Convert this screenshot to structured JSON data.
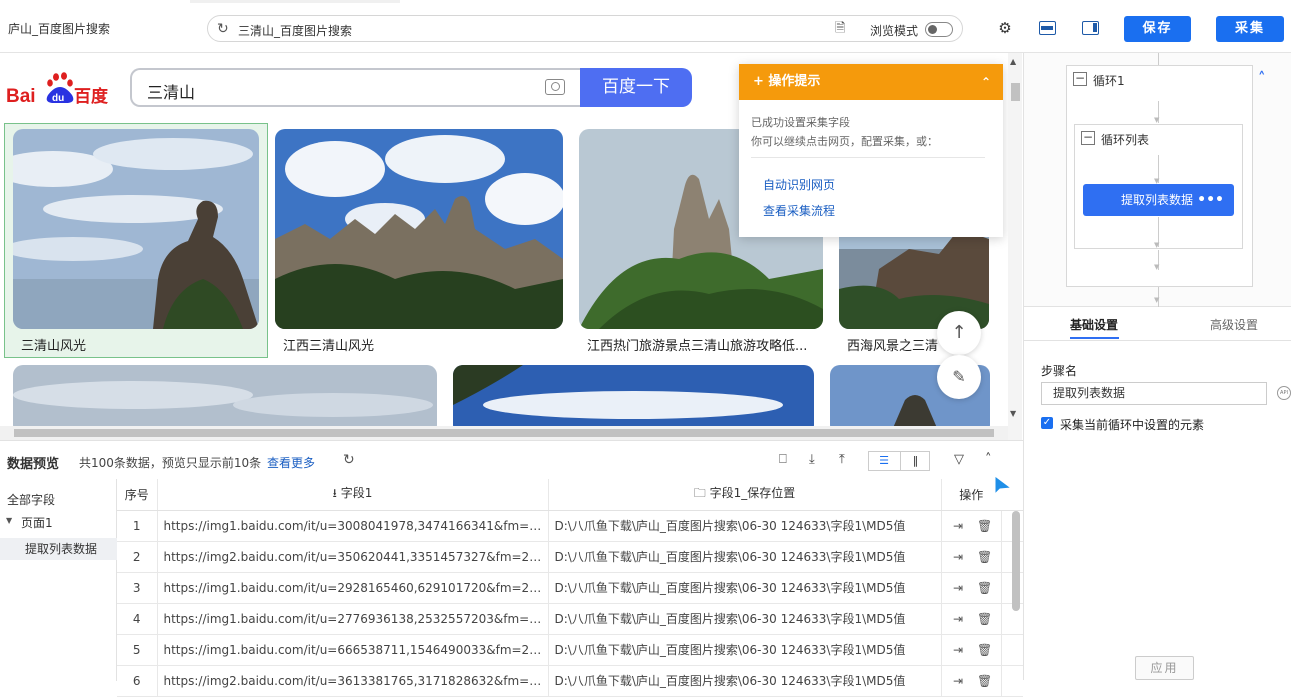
{
  "topbar": {
    "tab_title": "庐山_百度图片搜索",
    "url": "三清山_百度图片搜索",
    "browse_mode_label": "浏览模式",
    "browse_mode_on": false,
    "save_label": "保存",
    "collect_label": "采集",
    "accent_color": "#1a6ff0"
  },
  "webview": {
    "logo_text_bai": "Bai",
    "logo_text_du": "du",
    "logo_text_cn": "百度",
    "search_value": "三清山",
    "search_button": "百度一下",
    "images": [
      {
        "caption": "三清山风光",
        "selected": true
      },
      {
        "caption": "江西三清山风光"
      },
      {
        "caption": "江西热门旅游景点三清山旅游攻略低..."
      },
      {
        "caption": "西海风景之三清"
      }
    ],
    "tips": {
      "title": "操作提示",
      "line1": "已成功设置采集字段",
      "line2": "你可以继续点击网页，配置采集，或：",
      "link1": "自动识别网页",
      "link2": "查看采集流程",
      "header_color": "#f59a0c"
    }
  },
  "flow": {
    "loop1_label": "循环1",
    "loop_list_label": "循环列表",
    "extract_node_label": "提取列表数据",
    "more_label": "•••"
  },
  "settings": {
    "tab_basic": "基础设置",
    "tab_advanced": "高级设置",
    "step_name_label": "步骤名",
    "step_name_value": "提取列表数据",
    "api_label": "API",
    "checkbox_label": "采集当前循环中设置的元素",
    "checkbox_checked": true,
    "apply_label": "应用"
  },
  "preview": {
    "title": "数据预览",
    "summary": "共100条数据，预览只显示前10条",
    "view_more": "查看更多",
    "tree": {
      "all_fields": "全部字段",
      "page1": "页面1",
      "extract": "提取列表数据"
    },
    "columns": {
      "index": "序号",
      "field1": "字段1",
      "field1_path": "字段1_保存位置",
      "ops": "操作"
    },
    "rows": [
      {
        "idx": "1",
        "url": "https://img1.baidu.com/it/u=3008041978,3474166341&fm=253&fmt=...",
        "path": "D:\\八爪鱼下载\\庐山_百度图片搜索\\06-30 124633\\字段1\\MD5值"
      },
      {
        "idx": "2",
        "url": "https://img2.baidu.com/it/u=350620441,3351457327&fm=253&fmt=...",
        "path": "D:\\八爪鱼下载\\庐山_百度图片搜索\\06-30 124633\\字段1\\MD5值"
      },
      {
        "idx": "3",
        "url": "https://img1.baidu.com/it/u=2928165460,629101720&fm=253&fmt=...",
        "path": "D:\\八爪鱼下载\\庐山_百度图片搜索\\06-30 124633\\字段1\\MD5值"
      },
      {
        "idx": "4",
        "url": "https://img1.baidu.com/it/u=2776936138,2532557203&fm=253&fmt=...",
        "path": "D:\\八爪鱼下载\\庐山_百度图片搜索\\06-30 124633\\字段1\\MD5值"
      },
      {
        "idx": "5",
        "url": "https://img1.baidu.com/it/u=666538711,1546490033&fm=253&fmt=...",
        "path": "D:\\八爪鱼下载\\庐山_百度图片搜索\\06-30 124633\\字段1\\MD5值"
      },
      {
        "idx": "6",
        "url": "https://img2.baidu.com/it/u=3613381765,3171828632&fm=253&fmt=...",
        "path": "D:\\八爪鱼下载\\庐山_百度图片搜索\\06-30 124633\\字段1\\MD5值"
      }
    ]
  }
}
